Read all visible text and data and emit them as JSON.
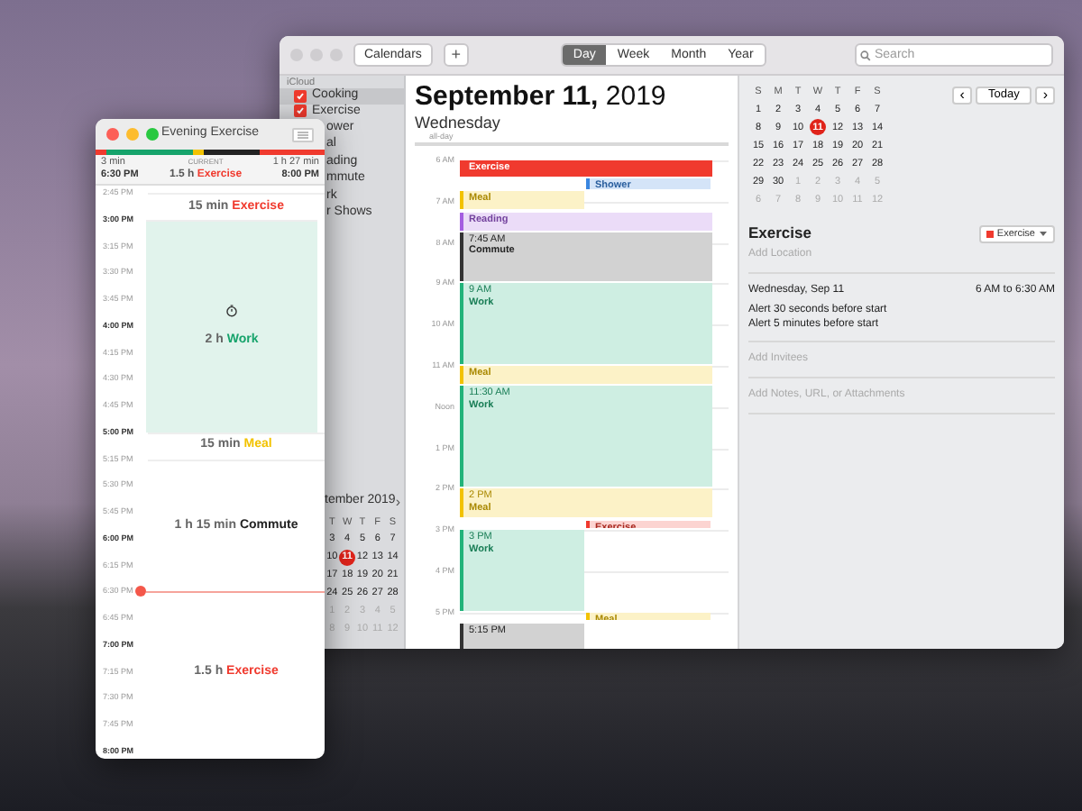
{
  "timer_window": {
    "title": "Evening Exercise",
    "header": {
      "left_top": "3 min",
      "left_bottom": "6:30 PM",
      "center_top": "CURRENT",
      "center_duration": "1.5 h",
      "center_category": "Exercise",
      "right_top": "1 h 27 min",
      "right_bottom": "8:00 PM"
    },
    "events": [
      {
        "duration": "15 min",
        "category": "Exercise",
        "color": "#f03a2e",
        "highlighted": false,
        "time_labels": [
          {
            "text": "2:45 PM",
            "kind": "quarter",
            "current": false
          }
        ]
      },
      {
        "duration": "2 h",
        "category": "Work",
        "color": "#16a36b",
        "highlighted": true,
        "time_labels": [
          {
            "text": "3:00 PM",
            "kind": "hour",
            "current": false
          },
          {
            "text": "3:15 PM",
            "kind": "quarter",
            "current": false
          },
          {
            "text": "3:30 PM",
            "kind": "quarter",
            "current": false
          },
          {
            "text": "3:45 PM",
            "kind": "quarter",
            "current": false
          },
          {
            "text": "4:00 PM",
            "kind": "hour",
            "current": false
          },
          {
            "text": "4:15 PM",
            "kind": "quarter",
            "current": false
          },
          {
            "text": "4:30 PM",
            "kind": "quarter",
            "current": false
          },
          {
            "text": "4:45 PM",
            "kind": "quarter",
            "current": false
          }
        ]
      },
      {
        "duration": "15 min",
        "category": "Meal",
        "color": "#f2c200",
        "highlighted": false,
        "time_labels": [
          {
            "text": "5:00 PM",
            "kind": "hour",
            "current": false
          }
        ]
      },
      {
        "duration": "1 h 15 min",
        "category": "Commute",
        "color": "#222222",
        "highlighted": false,
        "time_labels": [
          {
            "text": "5:15 PM",
            "kind": "quarter",
            "current": false
          },
          {
            "text": "5:30 PM",
            "kind": "quarter",
            "current": false
          },
          {
            "text": "5:45 PM",
            "kind": "quarter",
            "current": false
          },
          {
            "text": "6:00 PM",
            "kind": "hour",
            "current": false
          },
          {
            "text": "6:15 PM",
            "kind": "quarter",
            "current": false
          }
        ]
      },
      {
        "duration": "1.5 h",
        "category": "Exercise",
        "color": "#f03a2e",
        "highlighted": false,
        "time_labels": [
          {
            "text": "6:30 PM",
            "kind": "quarter",
            "current": true
          },
          {
            "text": "6:45 PM",
            "kind": "quarter",
            "current": false
          },
          {
            "text": "7:00 PM",
            "kind": "hour",
            "current": false
          },
          {
            "text": "7:15 PM",
            "kind": "quarter",
            "current": false
          },
          {
            "text": "7:30 PM",
            "kind": "quarter",
            "current": false
          },
          {
            "text": "7:45 PM",
            "kind": "quarter",
            "current": false
          }
        ]
      }
    ],
    "end_label": {
      "text": "8:00 PM",
      "kind": "hour"
    }
  },
  "calendar_window": {
    "toolbar": {
      "calendars_button": "Calendars",
      "add_button": "+",
      "views": [
        {
          "label": "Day",
          "selected": true
        },
        {
          "label": "Week",
          "selected": false
        },
        {
          "label": "Month",
          "selected": false
        },
        {
          "label": "Year",
          "selected": false
        }
      ],
      "search": {
        "placeholder": "Search"
      }
    },
    "sidebar": {
      "group": "iCloud",
      "items": [
        {
          "kind": "calendar",
          "label": "Cooking",
          "color": "#f03a2e",
          "checked": true,
          "selected": true
        },
        {
          "kind": "calendar",
          "label": "Exercise",
          "color": "#f03a2e",
          "checked": true,
          "selected": false
        },
        {
          "kind": "clipped",
          "label": "ower"
        },
        {
          "kind": "clipped",
          "label": "al"
        },
        {
          "kind": "clipped",
          "label": "ading"
        },
        {
          "kind": "clipped",
          "label": "mmute"
        },
        {
          "kind": "clipped",
          "label": "rk"
        },
        {
          "kind": "clipped",
          "label": "r Shows"
        }
      ],
      "mini_calendar": {
        "title": "tember 2019",
        "next": "›",
        "weekdays": [
          "T",
          "W",
          "T",
          "F",
          "S"
        ],
        "weeks": [
          [
            {
              "day": "3",
              "selected": false,
              "muted": false
            },
            {
              "day": "4",
              "selected": false,
              "muted": false
            },
            {
              "day": "5",
              "selected": false,
              "muted": false
            },
            {
              "day": "6",
              "selected": false,
              "muted": false
            },
            {
              "day": "7",
              "selected": false,
              "muted": false
            }
          ],
          [
            {
              "day": "10",
              "selected": false,
              "muted": false
            },
            {
              "day": "11",
              "selected": true,
              "muted": false
            },
            {
              "day": "12",
              "selected": false,
              "muted": false
            },
            {
              "day": "13",
              "selected": false,
              "muted": false
            },
            {
              "day": "14",
              "selected": false,
              "muted": false
            }
          ],
          [
            {
              "day": "17",
              "selected": false,
              "muted": false
            },
            {
              "day": "18",
              "selected": false,
              "muted": false
            },
            {
              "day": "19",
              "selected": false,
              "muted": false
            },
            {
              "day": "20",
              "selected": false,
              "muted": false
            },
            {
              "day": "21",
              "selected": false,
              "muted": false
            }
          ],
          [
            {
              "day": "24",
              "selected": false,
              "muted": false
            },
            {
              "day": "25",
              "selected": false,
              "muted": false
            },
            {
              "day": "26",
              "selected": false,
              "muted": false
            },
            {
              "day": "27",
              "selected": false,
              "muted": false
            },
            {
              "day": "28",
              "selected": false,
              "muted": false
            }
          ],
          [
            {
              "day": "1",
              "selected": false,
              "muted": true
            },
            {
              "day": "2",
              "selected": false,
              "muted": true
            },
            {
              "day": "3",
              "selected": false,
              "muted": true
            },
            {
              "day": "4",
              "selected": false,
              "muted": true
            },
            {
              "day": "5",
              "selected": false,
              "muted": true
            }
          ],
          [
            {
              "day": "8",
              "selected": false,
              "muted": true
            },
            {
              "day": "9",
              "selected": false,
              "muted": true
            },
            {
              "day": "10",
              "selected": false,
              "muted": true
            },
            {
              "day": "11",
              "selected": false,
              "muted": true
            },
            {
              "day": "12",
              "selected": false,
              "muted": true
            }
          ]
        ]
      }
    },
    "day_view": {
      "title": "**September 11,** 2019",
      "weekday": "Wednesday",
      "all_day_label": "all-day",
      "hours": [
        "6 AM",
        "7 AM",
        "8 AM",
        "9 AM",
        "10 AM",
        "11 AM",
        "Noon",
        "1 PM",
        "2 PM",
        "3 PM",
        "4 PM",
        "5 PM"
      ],
      "events": [
        {
          "title": "Exercise",
          "color": "#f03a2e",
          "selected": true
        },
        {
          "title": "Shower",
          "color": "#3a86e0",
          "selected": false
        },
        {
          "title": "Meal",
          "color": "#f2c200",
          "selected": false
        },
        {
          "title": "Reading",
          "color": "#a45ee0",
          "selected": false
        },
        {
          "title": "Commute",
          "time": "7:45 AM",
          "color": "#333333",
          "selected": false
        },
        {
          "title": "Work",
          "time": "9 AM",
          "color": "#22b37a",
          "selected": false
        },
        {
          "title": "Meal",
          "color": "#f2c200",
          "selected": false
        },
        {
          "title": "Work",
          "time": "11:30 AM",
          "color": "#22b37a",
          "selected": false
        },
        {
          "title": "Meal",
          "time": "2 PM",
          "color": "#f2c200",
          "selected": false
        },
        {
          "title": "Exercise",
          "color": "#f03a2e",
          "selected": false
        },
        {
          "title": "Work",
          "time": "3 PM",
          "color": "#22b37a",
          "selected": false
        },
        {
          "title": "Meal",
          "color": "#f2c200",
          "selected": false
        },
        {
          "time": "5:15 PM",
          "color": "#333333",
          "selected": false
        }
      ]
    },
    "inspector": {
      "today_button": "Today",
      "prev": "‹",
      "next": "›",
      "mini_calendar": {
        "weekdays": [
          "S",
          "M",
          "T",
          "W",
          "T",
          "F",
          "S"
        ],
        "weeks": [
          [
            {
              "day": "1",
              "selected": false,
              "muted": false
            },
            {
              "day": "2",
              "selected": false,
              "muted": false
            },
            {
              "day": "3",
              "selected": false,
              "muted": false
            },
            {
              "day": "4",
              "selected": false,
              "muted": false
            },
            {
              "day": "5",
              "selected": false,
              "muted": false
            },
            {
              "day": "6",
              "selected": false,
              "muted": false
            },
            {
              "day": "7",
              "selected": false,
              "muted": false
            }
          ],
          [
            {
              "day": "8",
              "selected": false,
              "muted": false
            },
            {
              "day": "9",
              "selected": false,
              "muted": false
            },
            {
              "day": "10",
              "selected": false,
              "muted": false
            },
            {
              "day": "11",
              "selected": true,
              "muted": false
            },
            {
              "day": "12",
              "selected": false,
              "muted": false
            },
            {
              "day": "13",
              "selected": false,
              "muted": false
            },
            {
              "day": "14",
              "selected": false,
              "muted": false
            }
          ],
          [
            {
              "day": "15",
              "selected": false,
              "muted": false
            },
            {
              "day": "16",
              "selected": false,
              "muted": false
            },
            {
              "day": "17",
              "selected": false,
              "muted": false
            },
            {
              "day": "18",
              "selected": false,
              "muted": false
            },
            {
              "day": "19",
              "selected": false,
              "muted": false
            },
            {
              "day": "20",
              "selected": false,
              "muted": false
            },
            {
              "day": "21",
              "selected": false,
              "muted": false
            }
          ],
          [
            {
              "day": "22",
              "selected": false,
              "muted": false
            },
            {
              "day": "23",
              "selected": false,
              "muted": false
            },
            {
              "day": "24",
              "selected": false,
              "muted": false
            },
            {
              "day": "25",
              "selected": false,
              "muted": false
            },
            {
              "day": "26",
              "selected": false,
              "muted": false
            },
            {
              "day": "27",
              "selected": false,
              "muted": false
            },
            {
              "day": "28",
              "selected": false,
              "muted": false
            }
          ],
          [
            {
              "day": "29",
              "selected": false,
              "muted": false
            },
            {
              "day": "30",
              "selected": false,
              "muted": false
            },
            {
              "day": "1",
              "selected": false,
              "muted": true
            },
            {
              "day": "2",
              "selected": false,
              "muted": true
            },
            {
              "day": "3",
              "selected": false,
              "muted": true
            },
            {
              "day": "4",
              "selected": false,
              "muted": true
            },
            {
              "day": "5",
              "selected": false,
              "muted": true
            }
          ],
          [
            {
              "day": "6",
              "selected": false,
              "muted": true
            },
            {
              "day": "7",
              "selected": false,
              "muted": true
            },
            {
              "day": "8",
              "selected": false,
              "muted": true
            },
            {
              "day": "9",
              "selected": false,
              "muted": true
            },
            {
              "day": "10",
              "selected": false,
              "muted": true
            },
            {
              "day": "11",
              "selected": false,
              "muted": true
            },
            {
              "day": "12",
              "selected": false,
              "muted": true
            }
          ]
        ]
      },
      "event_title": "Exercise",
      "calendar_select": {
        "label": "Exercise",
        "color": "#f03a2e"
      },
      "location_placeholder": "Add Location",
      "date": "Wednesday, Sep 11",
      "time_range": "6 AM to 6:30 AM",
      "alerts": [
        "Alert 30 seconds before start",
        "Alert 5 minutes before start"
      ],
      "invitees_placeholder": "Add Invitees",
      "notes_placeholder": "Add Notes, URL, or Attachments"
    }
  }
}
